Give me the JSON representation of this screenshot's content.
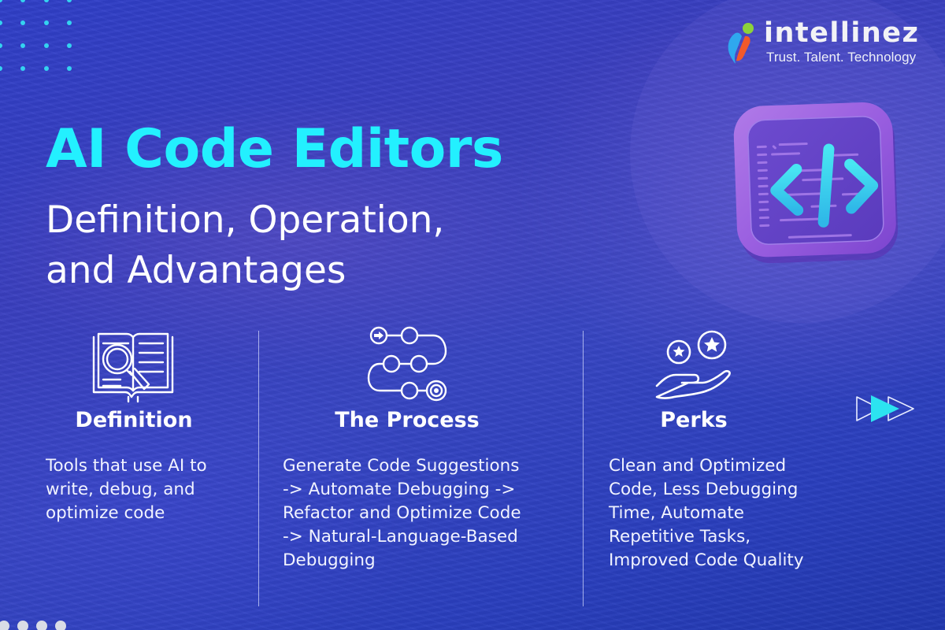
{
  "brand": {
    "name": "intellinez",
    "tagline": "Trust. Talent. Technology",
    "colors": {
      "logo_blue": "#2fa8ee",
      "logo_orange": "#f2592a",
      "logo_green": "#8cd23a"
    }
  },
  "hero": {
    "title": "AI Code Editors",
    "subtitle_line1": "Definition, Operation,",
    "subtitle_line2": "and Advantages",
    "title_color": "#23f0ff",
    "icon": "code-brackets-icon"
  },
  "columns": [
    {
      "icon": "book-magnifier-icon",
      "heading": "Definition",
      "body": "Tools that use AI to\nwrite, debug, and\noptimize code"
    },
    {
      "icon": "process-path-icon",
      "heading": "The Process",
      "body": "Generate Code Suggestions\n-> Automate Debugging ->\nRefactor and Optimize Code\n-> Natural-Language-Based\nDebugging"
    },
    {
      "icon": "hand-stars-icon",
      "heading": "Perks",
      "body": "Clean and Optimized\nCode, Less Debugging\nTime, Automate\nRepetitive Tasks,\nImproved Code Quality"
    }
  ],
  "decor": {
    "accent_cyan": "#34d3f0",
    "forward_arrows_icon": "fast-forward-icon"
  }
}
